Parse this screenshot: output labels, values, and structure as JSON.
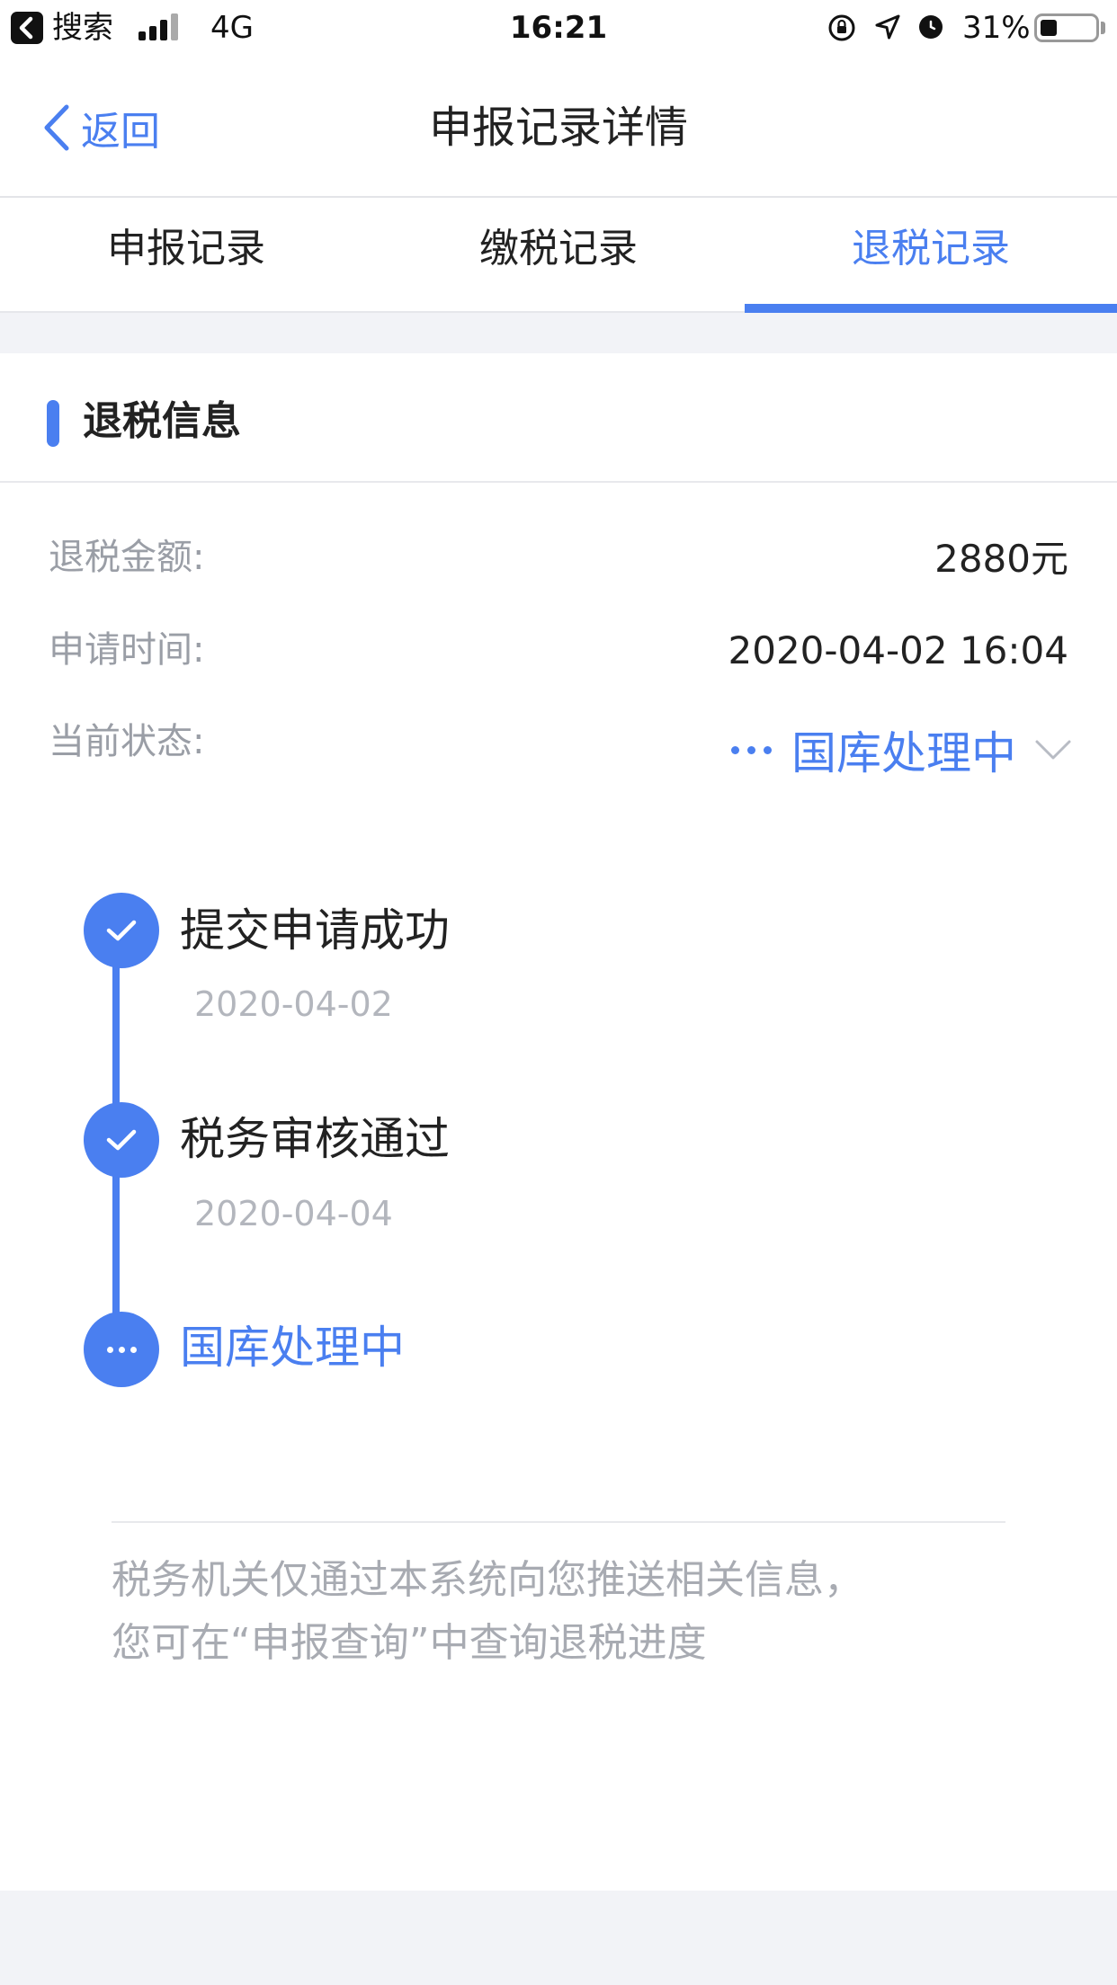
{
  "status_bar": {
    "back_app": "搜索",
    "network": "4G",
    "time": "16:21",
    "battery": "31%",
    "battery_level": 0.31
  },
  "nav": {
    "back_label": "返回",
    "title": "申报记录详情"
  },
  "tabs": [
    {
      "label": "申报记录",
      "active": false
    },
    {
      "label": "缴税记录",
      "active": false
    },
    {
      "label": "退税记录",
      "active": true
    }
  ],
  "section": {
    "title": "退税信息"
  },
  "details": {
    "amount_label": "退税金额:",
    "amount_value": "2880元",
    "time_label": "申请时间:",
    "time_value": "2020-04-02 16:04",
    "status_label": "当前状态:",
    "status_value": "国库处理中"
  },
  "timeline": [
    {
      "title": "提交申请成功",
      "date": "2020-04-02",
      "state": "done"
    },
    {
      "title": "税务审核通过",
      "date": "2020-04-04",
      "state": "done"
    },
    {
      "title": "国库处理中",
      "date": "",
      "state": "current"
    }
  ],
  "notice": {
    "line1": "税务机关仅通过本系统向您推送相关信息，",
    "line2": "您可在“申报查询”中查询退税进度"
  },
  "colors": {
    "accent": "#4a7ff0",
    "muted_text": "#9a9ea6",
    "background": "#f2f3f7"
  },
  "icons": [
    "back-app-icon",
    "signal-icon",
    "orientation-lock-icon",
    "location-icon",
    "alarm-icon",
    "battery-icon",
    "chevron-left-icon",
    "chevron-down-icon",
    "check-icon",
    "more-dots-icon"
  ]
}
